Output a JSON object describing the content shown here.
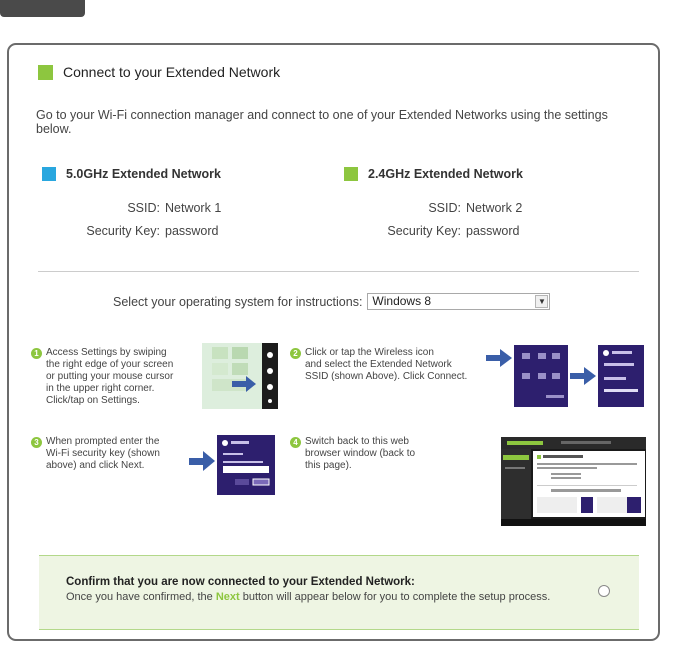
{
  "page": {
    "heading": "Connect to your Extended Network",
    "intro": "Go to your Wi-Fi connection manager and connect to one of your Extended Networks using the settings below."
  },
  "networks": {
    "n5": {
      "title": "5.0GHz Extended Network",
      "ssid_label": "SSID:",
      "ssid": "Network 1",
      "key_label": "Security Key:",
      "key": "password",
      "color": "#29a7df"
    },
    "n24": {
      "title": "2.4GHz Extended Network",
      "ssid_label": "SSID:",
      "ssid": "Network 2",
      "key_label": "Security Key:",
      "key": "password",
      "color": "#8dc63f"
    }
  },
  "os": {
    "label": "Select your operating system for instructions:",
    "selected": "Windows 8"
  },
  "steps": [
    {
      "num": "1",
      "text": "Access Settings by swiping\nthe right edge of your screen\nor putting your mouse cursor\nin the upper right corner.\nClick/tap on Settings."
    },
    {
      "num": "2",
      "text": "Click or tap the Wireless icon\nand select the Extended Network\nSSID (shown Above). Click Connect."
    },
    {
      "num": "3",
      "text": "When prompted enter the\nWi-Fi security key (shown\nabove) and click Next."
    },
    {
      "num": "4",
      "text": "Switch back to this web\nbrowser window (back to\nthis page)."
    }
  ],
  "confirm": {
    "title": "Confirm that you are now connected to your Extended Network:",
    "sub_before": "Once you have confirmed, the ",
    "sub_highlight": "Next",
    "sub_after": " button will appear below for you to complete the setup process."
  },
  "colors": {
    "accent_green": "#8dc63f",
    "accent_blue": "#29a7df",
    "win8_purple": "#2d1f6e"
  }
}
